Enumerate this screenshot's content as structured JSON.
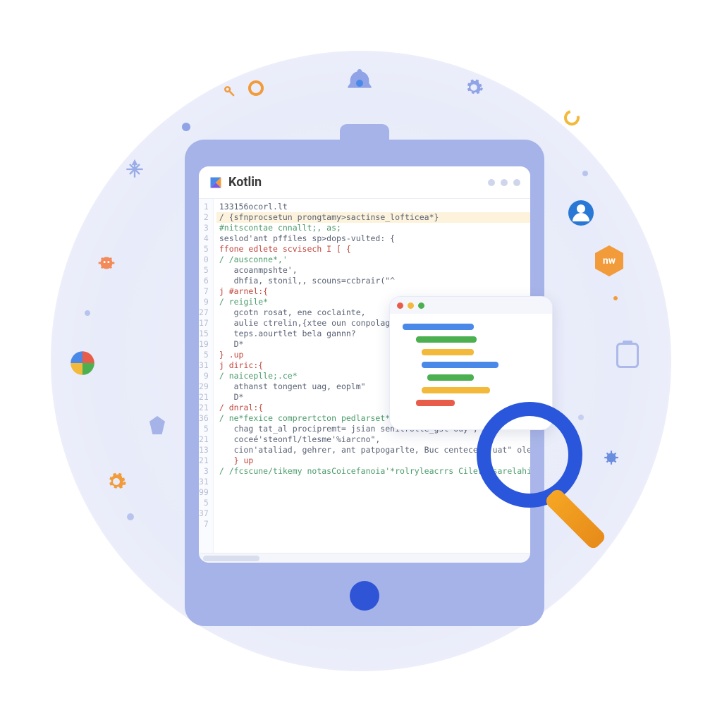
{
  "editor": {
    "title": "Kotlin",
    "gutter": [
      "1",
      "2",
      "3",
      "4",
      "5",
      "0",
      "5",
      "6",
      "7",
      "9",
      "27",
      "17",
      "15",
      "19",
      "5",
      "31",
      "9",
      "29",
      "21",
      "21",
      "36",
      "5",
      "21",
      "13",
      "21",
      "3",
      "31",
      "99",
      "5",
      "37",
      "7"
    ],
    "code": [
      {
        "cls": "",
        "txt": "133156ocorl.lt"
      },
      {
        "cls": "hl-line",
        "txt": "/ {sfnprocsetun prongtamy>sactinse_lofticea*}"
      },
      {
        "cls": "cm",
        "txt": "#nitscontae cnnallt;, as;"
      },
      {
        "cls": "",
        "txt": "seslod'ant pffiles sp>dops-vulted: {"
      },
      {
        "cls": "",
        "txt": ""
      },
      {
        "cls": "fn",
        "txt": "ffone edlete scvisech I [ {"
      },
      {
        "cls": "cm",
        "txt": "/ /ausconne*,'"
      },
      {
        "cls": "",
        "txt": "   acoanmpshte',"
      },
      {
        "cls": "",
        "txt": "   dhfia, stonil,, scouns=ccbrair(\"^"
      },
      {
        "cls": "",
        "txt": ""
      },
      {
        "cls": "fn",
        "txt": "j #arnel:{"
      },
      {
        "cls": "cm",
        "txt": "/ reigile*"
      },
      {
        "cls": "",
        "txt": "   gcotn rosat, ene coclainte,"
      },
      {
        "cls": "",
        "txt": "   aulie ctrelin,{xtee oun conpolagme,"
      },
      {
        "cls": "",
        "txt": "   teps.aourtlet bela gannn?"
      },
      {
        "cls": "",
        "txt": "   D*"
      },
      {
        "cls": "kw",
        "txt": "} .up"
      },
      {
        "cls": "",
        "txt": ""
      },
      {
        "cls": "fn",
        "txt": "j diric:{"
      },
      {
        "cls": "cm",
        "txt": "/ naiceplle;.ce*"
      },
      {
        "cls": "",
        "txt": "   athanst tongent uag, eoplm\""
      },
      {
        "cls": "",
        "txt": "   D*"
      },
      {
        "cls": "",
        "txt": ""
      },
      {
        "cls": "fn",
        "txt": "/ dnral:{"
      },
      {
        "cls": "cm",
        "txt": "/ ne*fexice comprertcton pedlarset*"
      },
      {
        "cls": "",
        "txt": "   chag tat_al procipremt= jsian senitrolle_gst ouy',"
      },
      {
        "cls": "",
        "txt": "   coceé'steonfl/tlesme'%iarcno\","
      },
      {
        "cls": "",
        "txt": "   cion'ataliad, gehrer, ant patpogarlte, Buc centeced, uat\" ole\","
      },
      {
        "cls": "kw",
        "txt": "   } up"
      },
      {
        "cls": "",
        "txt": ""
      },
      {
        "cls": "cm",
        "txt": "/ /fcscune/tikemy notasCoicefanoia'*rolryleacrrs Cilerlisarelahiny"
      }
    ]
  },
  "colors": {
    "accent": "#2a56db",
    "orange": "#f29b3a"
  },
  "mini_bars": [
    {
      "w": "52%",
      "c": "#4a89e8",
      "ml": "0"
    },
    {
      "w": "44%",
      "c": "#4cb050",
      "ml": "10%"
    },
    {
      "w": "38%",
      "c": "#f2b93b",
      "ml": "14%"
    },
    {
      "w": "56%",
      "c": "#4a89e8",
      "ml": "14%"
    },
    {
      "w": "34%",
      "c": "#4cb050",
      "ml": "18%"
    },
    {
      "w": "50%",
      "c": "#f2b93b",
      "ml": "14%"
    },
    {
      "w": "28%",
      "c": "#e85c4a",
      "ml": "10%"
    }
  ],
  "badge_text": "nw"
}
